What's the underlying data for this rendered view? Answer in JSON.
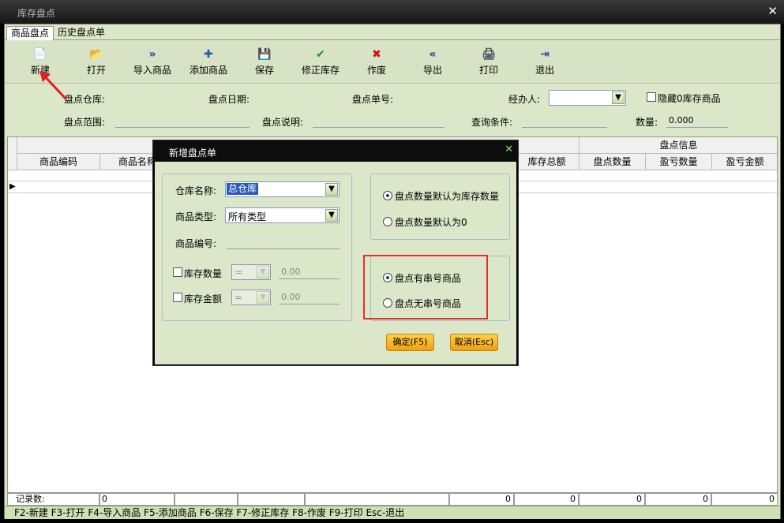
{
  "window": {
    "title": "库存盘点",
    "close": "✕"
  },
  "tabs": [
    "商品盘点",
    "历史盘点单"
  ],
  "toolbar": [
    {
      "icon": "new-icon",
      "glyph": "📄",
      "label": "新建",
      "color": "#4060a0"
    },
    {
      "icon": "open-icon",
      "glyph": "📂",
      "label": "打开",
      "color": "#c09030"
    },
    {
      "icon": "import-icon",
      "glyph": "»",
      "label": "导入商品",
      "color": "#1a3d9a"
    },
    {
      "icon": "plus-icon",
      "glyph": "✚",
      "label": "添加商品",
      "color": "#1a5ac0"
    },
    {
      "icon": "save-icon",
      "glyph": "💾",
      "label": "保存",
      "color": "#1a3d9a"
    },
    {
      "icon": "check-icon",
      "glyph": "✔",
      "label": "修正库存",
      "color": "#10a010"
    },
    {
      "icon": "cross-icon",
      "glyph": "✖",
      "label": "作废",
      "color": "#d01010"
    },
    {
      "icon": "export-icon",
      "glyph": "«",
      "label": "导出",
      "color": "#1a3d9a"
    },
    {
      "icon": "print-icon",
      "glyph": "🖨",
      "label": "打印",
      "color": "#405060"
    },
    {
      "icon": "exit-icon",
      "glyph": "⇥",
      "label": "退出",
      "color": "#3050a0"
    }
  ],
  "form": {
    "warehouse_label": "盘点仓库:",
    "date_label": "盘点日期:",
    "order_no_label": "盘点单号:",
    "handler_label": "经办人:",
    "hide_zero_label": "隐藏0库存商品",
    "range_label": "盘点范围:",
    "desc_label": "盘点说明:",
    "query_label": "查询条件:",
    "qty_label": "数量:",
    "qty_value": "0.000"
  },
  "grid": {
    "group_header": "盘点信息",
    "columns": [
      "商品编码",
      "商品名称",
      "库存总额",
      "盘点数量",
      "盈亏数量",
      "盈亏金额"
    ]
  },
  "footer": {
    "count_label": "记录数:",
    "count_value": "0",
    "totals": [
      "0",
      "0",
      "0",
      "0",
      "0"
    ]
  },
  "hint": "F2-新建 F3-打开 F4-导入商品 F5-添加商品 F6-保存 F7-修正库存 F8-作废 F9-打印 Esc-退出",
  "dialog": {
    "title": "新增盘点单",
    "close": "✕",
    "warehouse_label": "仓库名称:",
    "warehouse_value": "总仓库",
    "type_label": "商品类型:",
    "type_value": "所有类型",
    "code_label": "商品编号:",
    "stock_qty_label": "库存数量",
    "stock_amt_label": "库存金额",
    "op_value": "=",
    "num_value": "0.00",
    "radio_default_stock": "盘点数量默认为库存数量",
    "radio_default_zero": "盘点数量默认为0",
    "radio_with_serial": "盘点有串号商品",
    "radio_without_serial": "盘点无串号商品",
    "ok_button": "确定(F5)",
    "cancel_button": "取消(Esc)"
  }
}
